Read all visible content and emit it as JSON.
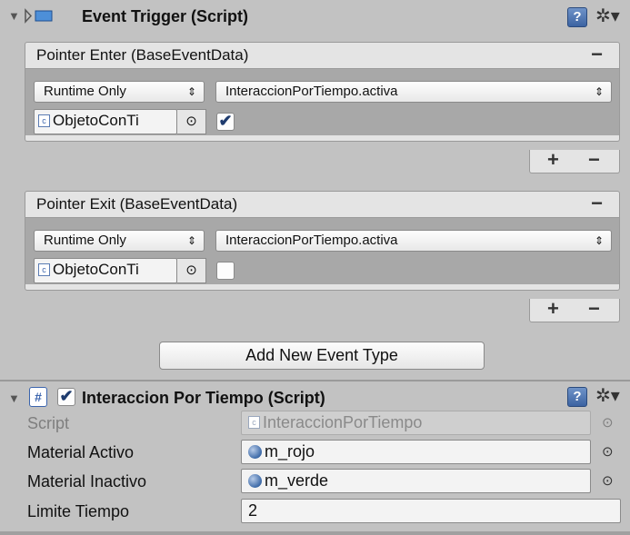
{
  "event_trigger": {
    "title": "Event Trigger (Script)",
    "foldout": "▼",
    "events": [
      {
        "title": "Pointer Enter (BaseEventData)",
        "runtime": "Runtime Only",
        "function": "InteraccionPorTiempo.activa",
        "object": "ObjetoConTi",
        "checked": true,
        "check_glyph": "✔"
      },
      {
        "title": "Pointer Exit (BaseEventData)",
        "runtime": "Runtime Only",
        "function": "InteraccionPorTiempo.activa",
        "object": "ObjetoConTi",
        "checked": false,
        "check_glyph": ""
      }
    ],
    "add_button": "Add New Event Type",
    "plus": "+",
    "minus": "−",
    "dropdown_arrows": "⇕",
    "picker": "⊙"
  },
  "interaccion": {
    "title": "Interaccion Por Tiempo (Script)",
    "enabled_glyph": "✔",
    "properties": [
      {
        "label": "Script",
        "value": "InteraccionPorTiempo",
        "disabled": true
      },
      {
        "label": "Material Activo",
        "value": "m_rojo"
      },
      {
        "label": "Material Inactivo",
        "value": "m_verde"
      },
      {
        "label": "Limite Tiempo",
        "value": "2"
      }
    ]
  },
  "icons": {
    "help": "?",
    "gear": "✲▾",
    "script": "#",
    "obj": "c"
  }
}
